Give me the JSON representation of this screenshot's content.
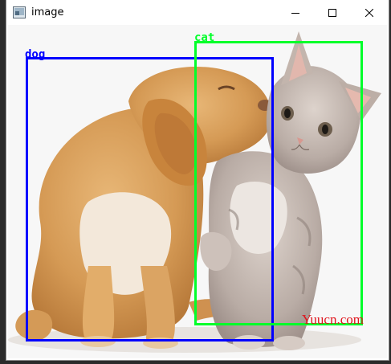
{
  "window": {
    "title": "image"
  },
  "detections": [
    {
      "label": "dog",
      "color": "#0000ff"
    },
    {
      "label": "cat",
      "color": "#00ff2a"
    }
  ],
  "watermark": "Yuucn.com",
  "colors": {
    "dog_box": "#0000ff",
    "cat_box": "#00ff2a",
    "watermark": "#e0141c"
  },
  "icons": [
    "app-icon",
    "minimize-icon",
    "maximize-icon",
    "close-icon"
  ]
}
